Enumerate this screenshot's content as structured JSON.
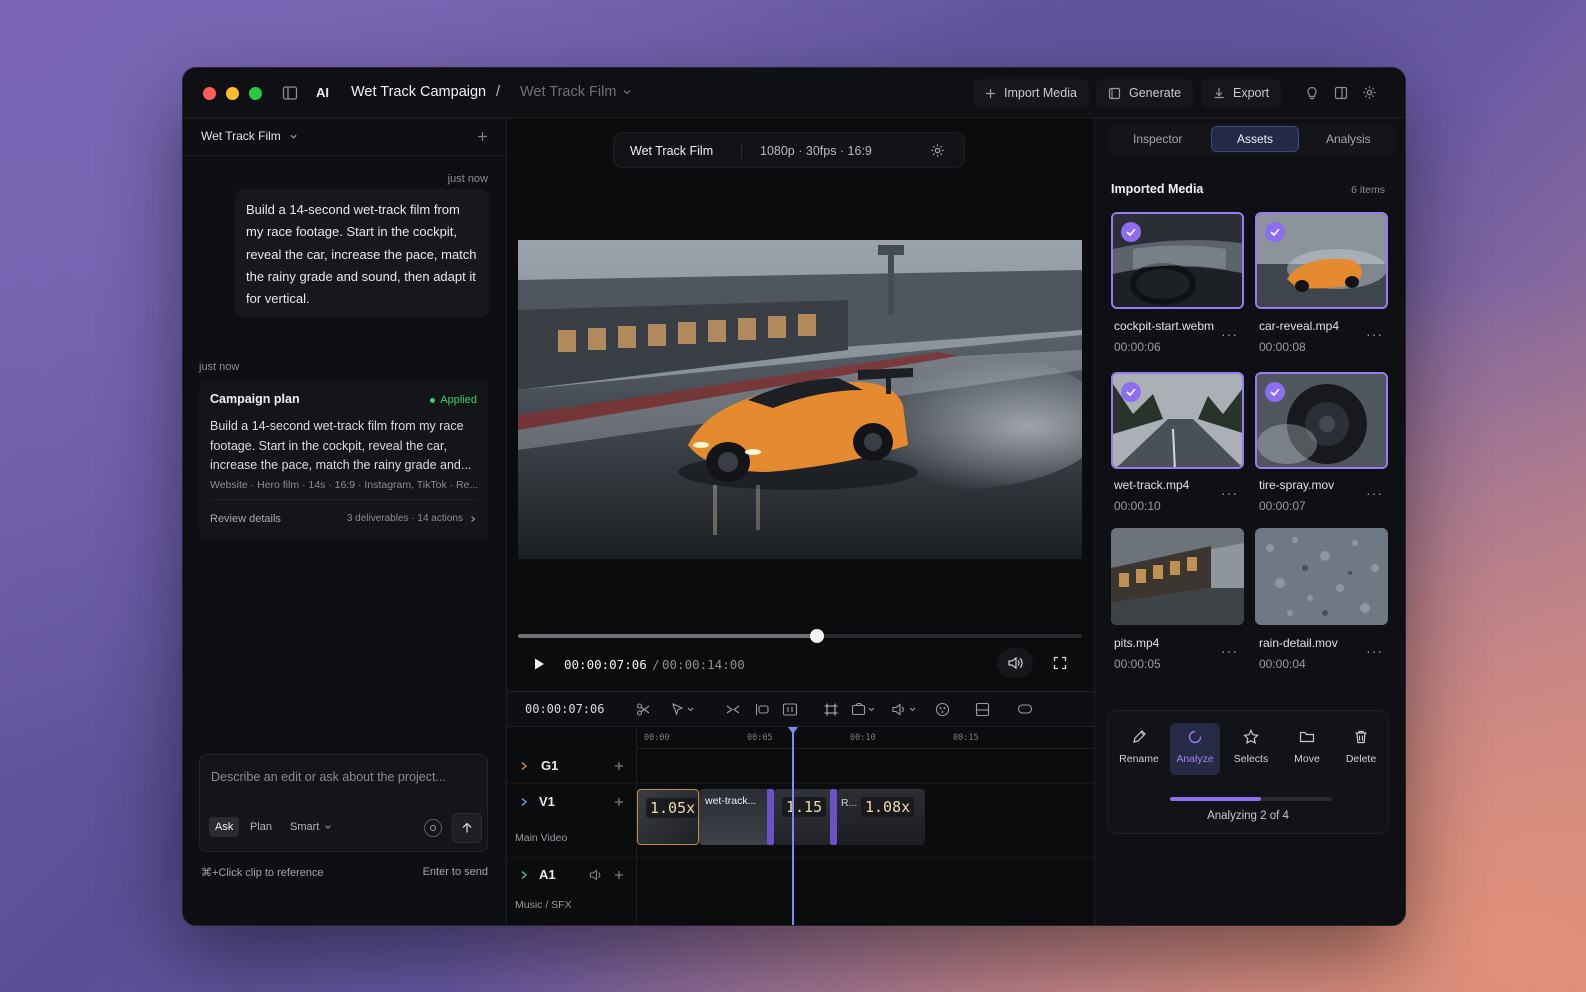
{
  "titlebar": {
    "ai_label": "AI",
    "project": "Wet Track Campaign",
    "separator": "/",
    "film": "Wet Track Film",
    "import": "Import Media",
    "generate": "Generate",
    "export": "Export"
  },
  "left": {
    "header": "Wet Track Film",
    "msg_time": "just now",
    "user_message": "Build a 14-second wet-track film from my race footage. Start in the cockpit, reveal the car, increase the pace, match the rainy grade and sound, then adapt it for vertical.",
    "plan_time": "just now",
    "plan": {
      "title": "Campaign plan",
      "status": "Applied",
      "body": "Build a 14-second wet-track film from my race footage. Start in the cockpit, reveal the car, increase the pace, match the rainy grade and...",
      "meta": "Website · Hero film · 14s · 16:9 · Instagram, TikTok · Re...",
      "review": "Review details",
      "summary": "3 deliverables · 14 actions"
    },
    "input_placeholder": "Describe an edit or ask about the project...",
    "modes": [
      "Ask",
      "Plan"
    ],
    "model": "Smart",
    "hint_left": "⌘+Click clip to reference",
    "hint_right": "Enter to send"
  },
  "center": {
    "project_name": "Wet Track Film",
    "format": "1080p · 30fps · 16:9",
    "playhead_fraction": 0.53,
    "time_current": "00:00:07:06",
    "time_sep": "/",
    "time_total": "00:00:14:00",
    "timeline_time": "00:00:07:06",
    "ruler": [
      "00:00",
      "00:05",
      "00:10",
      "00:15"
    ],
    "tracks": {
      "g1": "G1",
      "v1": "V1",
      "v1_sub": "Main Video",
      "a1": "A1",
      "a1_sub": "Music / SFX"
    },
    "clips": {
      "c1_speed": "1.05x",
      "c2_label": "wet-track...",
      "c3_speed": "1.15",
      "c3_label": "R...",
      "c4_speed": "1.08x"
    }
  },
  "right": {
    "tabs": [
      "Inspector",
      "Assets",
      "Analysis"
    ],
    "active_tab": "Assets",
    "section_title": "Imported Media",
    "count": "6 items",
    "assets": [
      {
        "name": "cockpit-start.webm",
        "duration": "00:00:06",
        "selected": true
      },
      {
        "name": "car-reveal.mp4",
        "duration": "00:00:08",
        "selected": true
      },
      {
        "name": "wet-track.mp4",
        "duration": "00:00:10",
        "selected": true
      },
      {
        "name": "tire-spray.mov",
        "duration": "00:00:07",
        "selected": true
      },
      {
        "name": "pits.mp4",
        "duration": "00:00:05",
        "selected": false
      },
      {
        "name": "rain-detail.mov",
        "duration": "00:00:04",
        "selected": false
      }
    ],
    "actions": [
      "Rename",
      "Analyze",
      "Selects",
      "Move",
      "Delete"
    ],
    "progress_fraction": 0.56,
    "progress_label": "Analyzing 2 of 4"
  },
  "colors": {
    "accent": "#8d6ef0",
    "applied_green": "#3ecf6e",
    "speed_text": "#f3d9a5"
  }
}
